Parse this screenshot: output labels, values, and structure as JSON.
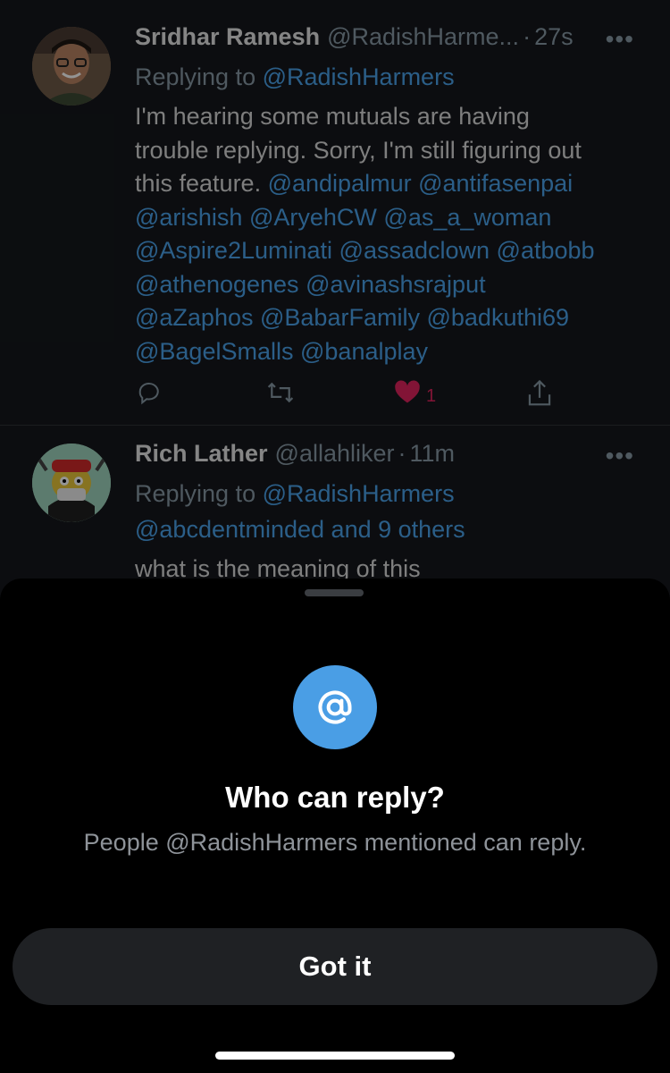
{
  "tweets": [
    {
      "name": "Sridhar Ramesh",
      "handle": "@RadishHarme...",
      "dot": "·",
      "time": "27s",
      "more": "•••",
      "replying_label": "Replying to",
      "replying_handle": "@RadishHarmers",
      "body_line1": "I'm hearing some mutuals are having",
      "body_line2": "trouble replying. Sorry, I'm still figuring out",
      "body_line3_text": "this feature.",
      "mentions": [
        "@andipalmur",
        "@antifasenpai",
        "@arishish",
        "@AryehCW",
        "@as_a_woman",
        "@Aspire2Luminati",
        "@assadclown",
        "@atbobb",
        "@athenogenes",
        "@avinashsrajput",
        "@aZaphos",
        "@BabarFamily",
        "@badkuthi69",
        "@BagelSmalls",
        "@banalplay"
      ],
      "like_count": "1",
      "icons": [
        "reply-icon",
        "retweet-icon",
        "heart-icon",
        "share-icon"
      ]
    },
    {
      "name": "Rich Lather",
      "handle": "@allahliker",
      "dot": "·",
      "time": "11m",
      "more": "•••",
      "replying_label": "Replying to",
      "replying_handle": "@RadishHarmers",
      "replying_line2": "@abcdentminded and 9 others",
      "body_line1": "what is the meaning of this"
    }
  ],
  "sheet": {
    "icon": "at-icon",
    "icon_color": "#4a9ee5",
    "title": "Who can reply?",
    "subtitle": "People @RadishHarmers mentioned can reply.",
    "button_label": "Got it"
  },
  "colors": {
    "background": "#15181c",
    "link": "#4aa3ea",
    "like": "#e0245e",
    "sheet": "#000000"
  }
}
